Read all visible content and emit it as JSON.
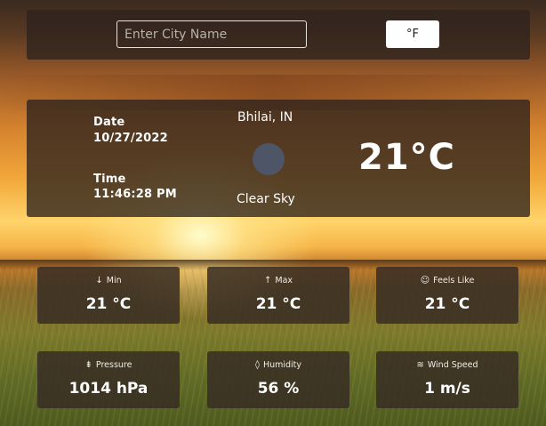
{
  "search": {
    "placeholder": "Enter City Name"
  },
  "unit_toggle": {
    "label": "°F"
  },
  "current": {
    "date_label": "Date",
    "date_value": "10/27/2022",
    "time_label": "Time",
    "time_value": "11:46:28 PM",
    "city": "Bhilai, IN",
    "description": "Clear Sky",
    "temperature": "21°C",
    "icon": "clear-sky-icon"
  },
  "stats": [
    {
      "label": "Min",
      "value": "21 °C",
      "icon": "arrow-down-icon",
      "glyph": "↓"
    },
    {
      "label": "Max",
      "value": "21 °C",
      "icon": "arrow-up-icon",
      "glyph": "↑"
    },
    {
      "label": "Feels Like",
      "value": "21 °C",
      "icon": "smile-icon",
      "glyph": "☺"
    },
    {
      "label": "Pressure",
      "value": "1014 hPa",
      "icon": "pressure-icon",
      "glyph": "⇟"
    },
    {
      "label": "Humidity",
      "value": "56 %",
      "icon": "droplet-icon",
      "glyph": "◊"
    },
    {
      "label": "Wind Speed",
      "value": "1 m/s",
      "icon": "wind-icon",
      "glyph": "≋"
    }
  ],
  "colors": {
    "panel": "#2d231e",
    "toggle_bg": "#ffffff",
    "icon_circle": "#4e5566"
  }
}
